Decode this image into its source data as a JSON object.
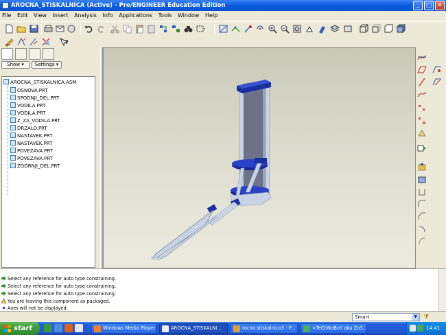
{
  "window": {
    "title": "AROCNA_STISKALNICA (Active) - Pro/ENGINEER Education Edition",
    "minimize": "_",
    "maximize": "□",
    "close": "✕"
  },
  "menu": [
    {
      "label": "File"
    },
    {
      "label": "Edit"
    },
    {
      "label": "View"
    },
    {
      "label": "Insert"
    },
    {
      "label": "Analysis"
    },
    {
      "label": "Info"
    },
    {
      "label": "Applications"
    },
    {
      "label": "Tools"
    },
    {
      "label": "Window"
    },
    {
      "label": "Help"
    }
  ],
  "model_tree": {
    "show_label": "Show",
    "settings_label": "Settings",
    "root": "AROCNA_STISKALNICA.ASM",
    "items": [
      {
        "label": "OSNOVA.PRT"
      },
      {
        "label": "SPODNJI_DEL.PRT"
      },
      {
        "label": "VODILA.PRT"
      },
      {
        "label": "VODILA.PRT"
      },
      {
        "label": "Z_ZA_VODILA.PRT"
      },
      {
        "label": "DRZALO.PRT"
      },
      {
        "label": "NASTAVEK.PRT"
      },
      {
        "label": "NASTAVEK.PRT"
      },
      {
        "label": "POVEZAVA.PRT"
      },
      {
        "label": "POVEZAVA.PRT"
      },
      {
        "label": "ZGORNJI_DEL.PRT"
      }
    ]
  },
  "messages": [
    {
      "icon": "green-arrow-icon",
      "text": "Select any reference for auto type constraining."
    },
    {
      "icon": "green-arrow-icon",
      "text": "Select any reference for auto type constraining."
    },
    {
      "icon": "green-arrow-icon",
      "text": "Select any reference for auto type constraining."
    },
    {
      "icon": "warning-icon",
      "text": "You are leaving this component as packaged."
    },
    {
      "icon": "bullet-icon",
      "text": "Axes will not be displayed."
    }
  ],
  "status": {
    "filter_value": "Smart"
  },
  "taskbar": {
    "start_label": "start",
    "tasks": [
      {
        "label": "Windows Media Player",
        "active": false
      },
      {
        "label": "AROCNA_STISKALNI...",
        "active": true
      },
      {
        "label": "rocna stiskalnica3 - P...",
        "active": false
      },
      {
        "label": "<TeChNoBoY aka Za3...",
        "active": false
      }
    ],
    "clock": "14:41"
  },
  "colors": {
    "titlebar": "#0a5fe0",
    "taskbar": "#245edb",
    "start_green": "#3c9c3c",
    "model_frame": "#1a2fa0",
    "model_rail": "#c8d4e6"
  }
}
